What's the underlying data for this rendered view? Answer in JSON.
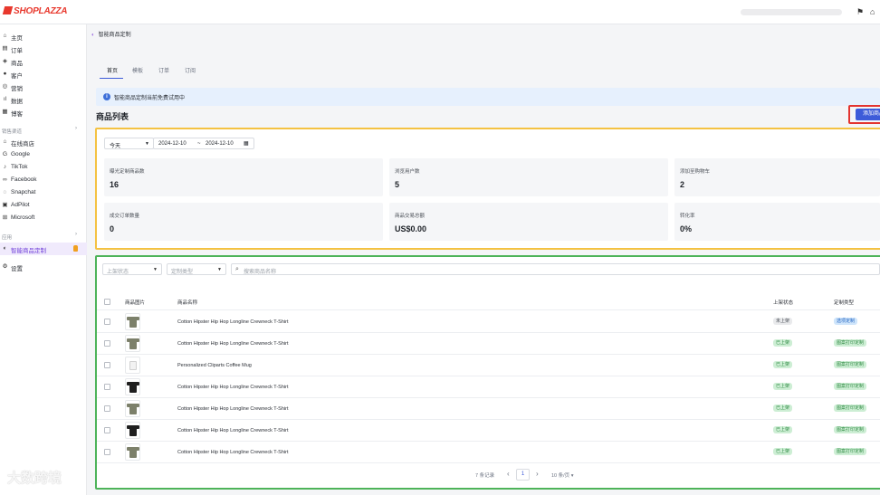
{
  "brand": {
    "name": "SHOPLAZZA",
    "color": "#e8382d"
  },
  "topbar": {
    "flag_icon": "flag-icon",
    "store_icon": "store-icon"
  },
  "sidebar": {
    "items": [
      {
        "icon": "home-icon",
        "glyph": "⌂",
        "label": "主页"
      },
      {
        "icon": "order-icon",
        "glyph": "▤",
        "label": "订单"
      },
      {
        "icon": "tag-icon",
        "glyph": "◈",
        "label": "商品"
      },
      {
        "icon": "user-icon",
        "glyph": "●",
        "label": "客户"
      },
      {
        "icon": "marketing-icon",
        "glyph": "◎",
        "label": "营销"
      },
      {
        "icon": "chart-icon",
        "glyph": "ıl",
        "label": "数据"
      },
      {
        "icon": "blog-icon",
        "glyph": "▦",
        "label": "博客"
      }
    ],
    "channels_title": "销售渠道",
    "channels": [
      {
        "icon": "store-icon",
        "glyph": "⌂",
        "label": "在线商店"
      },
      {
        "icon": "google-icon",
        "glyph": "G",
        "label": "Google"
      },
      {
        "icon": "tiktok-icon",
        "glyph": "♪",
        "label": "TikTok"
      },
      {
        "icon": "facebook-icon",
        "glyph": "∞",
        "label": "Facebook"
      },
      {
        "icon": "snapchat-icon",
        "glyph": "◌",
        "label": "Snapchat"
      },
      {
        "icon": "adpilot-icon",
        "glyph": "▣",
        "label": "AdPilot"
      },
      {
        "icon": "microsoft-icon",
        "glyph": "⊞",
        "label": "Microsoft"
      }
    ],
    "apps_title": "应用",
    "apps": [
      {
        "icon": "custom-product-icon",
        "glyph": "◐",
        "label": "智能商品定制"
      }
    ],
    "settings": {
      "icon": "gear-icon",
      "glyph": "⚙",
      "label": "设置"
    }
  },
  "breadcrumb": {
    "label": "智能商品定制"
  },
  "tabs": [
    {
      "label": "首页"
    },
    {
      "label": "模板"
    },
    {
      "label": "订单"
    },
    {
      "label": "订阅"
    }
  ],
  "notice": {
    "text": "智能商品定制当前免费试用中"
  },
  "list": {
    "title": "商品列表",
    "add_button": "添加商品"
  },
  "stats": {
    "period": "今天",
    "date_start": "2024-12-10",
    "date_sep": "~",
    "date_end": "2024-12-10",
    "cards": [
      {
        "label": "曝光定制商品数",
        "value": "16"
      },
      {
        "label": "浏览用户数",
        "value": "5"
      },
      {
        "label": "添加至购物车",
        "value": "2"
      },
      {
        "label": "成交订单数量",
        "value": "0"
      },
      {
        "label": "商品交易总额",
        "value": "US$0.00"
      },
      {
        "label": "转化率",
        "value": "0%"
      }
    ]
  },
  "filters": {
    "status_placeholder": "上架状态",
    "type_placeholder": "定制类型",
    "search_placeholder": "搜索商品名称"
  },
  "table": {
    "headers": {
      "image": "商品图片",
      "name": "商品名称",
      "status": "上架状态",
      "type": "定制类型"
    },
    "rows": [
      {
        "name": "Cotton Hipster Hip Hop Longline Crewneck T-Shirt",
        "thumb": "shirt",
        "color": "#7c806a",
        "status": "未上架",
        "status_kind": "gray",
        "type": "选项定制",
        "type_kind": "blue"
      },
      {
        "name": "Cotton Hipster Hip Hop Longline Crewneck T-Shirt",
        "thumb": "shirt",
        "color": "#7c806a",
        "status": "已上架",
        "status_kind": "green",
        "type": "图案打印定制",
        "type_kind": "green"
      },
      {
        "name": "Personalized Cliparts Coffee Mug",
        "thumb": "mug",
        "color": "#f2f2f2",
        "status": "已上架",
        "status_kind": "green",
        "type": "图案打印定制",
        "type_kind": "green"
      },
      {
        "name": "Cotton Hipster Hip Hop Longline Crewneck T-Shirt",
        "thumb": "shirt",
        "color": "#1f1f1f",
        "status": "已上架",
        "status_kind": "green",
        "type": "图案打印定制",
        "type_kind": "green"
      },
      {
        "name": "Cotton Hipster Hip Hop Longline Crewneck T-Shirt",
        "thumb": "shirt",
        "color": "#7c806a",
        "status": "已上架",
        "status_kind": "green",
        "type": "图案打印定制",
        "type_kind": "green"
      },
      {
        "name": "Cotton Hipster Hip Hop Longline Crewneck T-Shirt",
        "thumb": "shirt",
        "color": "#1f1f1f",
        "status": "已上架",
        "status_kind": "green",
        "type": "图案打印定制",
        "type_kind": "green"
      },
      {
        "name": "Cotton Hipster Hip Hop Longline Crewneck T-Shirt",
        "thumb": "shirt",
        "color": "#7c806a",
        "status": "已上架",
        "status_kind": "green",
        "type": "图案打印定制",
        "type_kind": "green"
      }
    ]
  },
  "pagination": {
    "total": "7 条记录",
    "prev": "‹",
    "page": "1",
    "next": "›",
    "page_size": "10 条/页"
  },
  "watermark": "大数跨境",
  "colors": {
    "accent": "#3d5bd9",
    "stats_border": "#f4c242",
    "table_border": "#4db359",
    "button_highlight": "#e3342f"
  }
}
